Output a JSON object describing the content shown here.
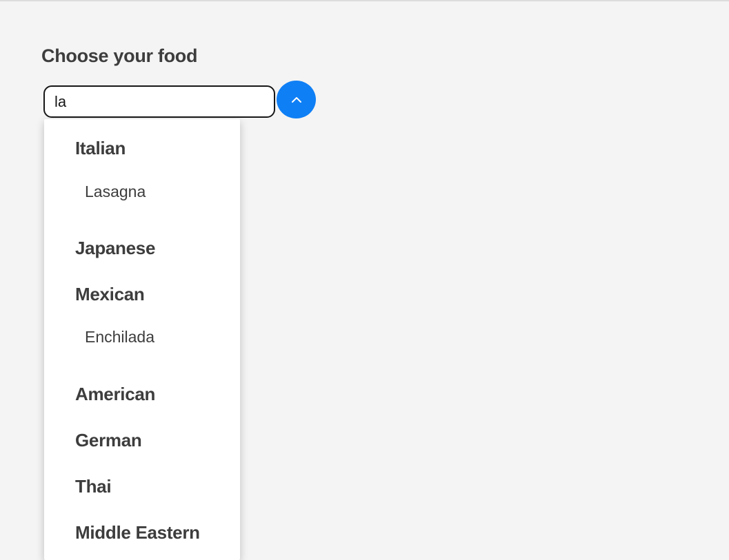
{
  "form": {
    "label": "Choose your food",
    "input_value": "la",
    "toggle_icon": "chevron-up-icon",
    "accent_color": "#0f7ff5"
  },
  "dropdown": {
    "groups": [
      {
        "label": "Italian",
        "options": [
          "Lasagna"
        ]
      },
      {
        "label": "Japanese",
        "options": []
      },
      {
        "label": "Mexican",
        "options": [
          "Enchilada"
        ]
      },
      {
        "label": "American",
        "options": []
      },
      {
        "label": "German",
        "options": []
      },
      {
        "label": "Thai",
        "options": []
      },
      {
        "label": "Middle Eastern",
        "options": []
      }
    ]
  }
}
